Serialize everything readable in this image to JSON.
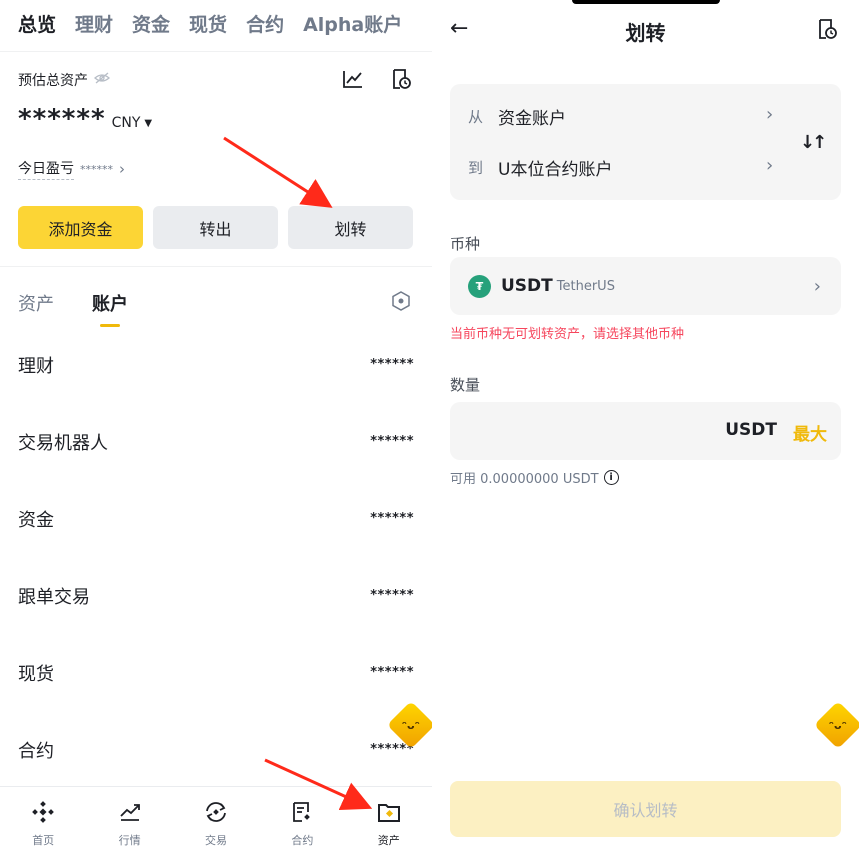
{
  "left": {
    "topnav": [
      "总览",
      "理财",
      "资金",
      "现货",
      "合约",
      "Alpha账户"
    ],
    "est_label": "预估总资产",
    "balance_masked": "******",
    "currency": "CNY",
    "pnl_label": "今日盈亏",
    "pnl_value": "******",
    "buttons": {
      "add": "添加资金",
      "withdraw": "转出",
      "transfer": "划转"
    },
    "subtabs": [
      "资产",
      "账户"
    ],
    "accounts": [
      {
        "name": "理财",
        "value": "******"
      },
      {
        "name": "交易机器人",
        "value": "******"
      },
      {
        "name": "资金",
        "value": "******"
      },
      {
        "name": "跟单交易",
        "value": "******"
      },
      {
        "name": "现货",
        "value": "******"
      },
      {
        "name": "合约",
        "value": "******"
      }
    ],
    "bottom_nav": [
      {
        "label": "首页",
        "icon": "home-icon"
      },
      {
        "label": "行情",
        "icon": "market-icon"
      },
      {
        "label": "交易",
        "icon": "trade-icon"
      },
      {
        "label": "合约",
        "icon": "futures-icon"
      },
      {
        "label": "资产",
        "icon": "wallet-icon"
      }
    ]
  },
  "right": {
    "title": "划转",
    "from_prefix": "从",
    "from_account": "资金账户",
    "to_prefix": "到",
    "to_account": "U本位合约账户",
    "coin_label": "币种",
    "coin_symbol": "USDT",
    "coin_name": "TetherUS",
    "warning": "当前币种无可划转资产，请选择其他币种",
    "amount_label": "数量",
    "amount_unit": "USDT",
    "max_label": "最大",
    "available": "可用 0.00000000 USDT",
    "confirm": "确认划转"
  },
  "colors": {
    "accent": "#fcd535",
    "accent_text": "#f0b90b",
    "warning": "#f6465d",
    "arrow": "#ff2a1a"
  }
}
